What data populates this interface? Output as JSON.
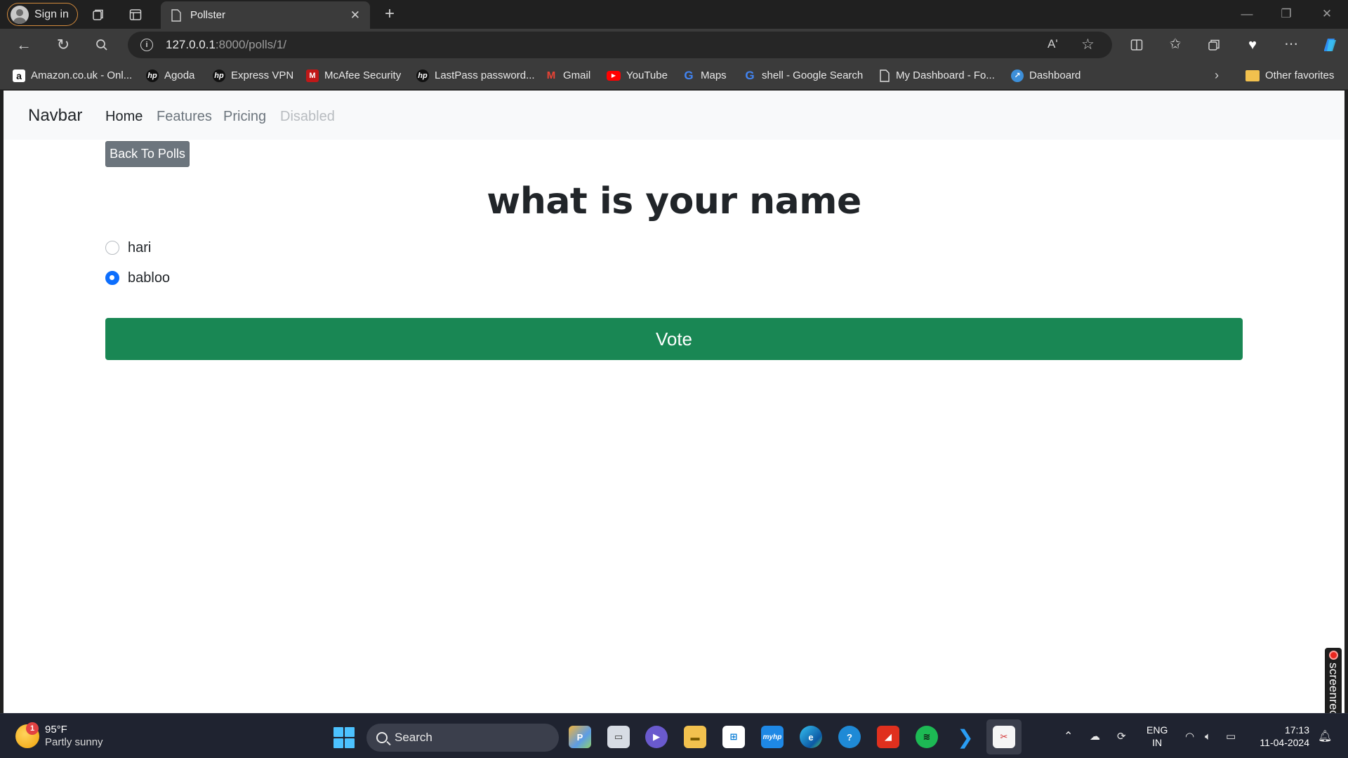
{
  "browser": {
    "signin_label": "Sign in",
    "tab_title": "Pollster",
    "url_host": "127.0.0.1",
    "url_path": ":8000/polls/1/",
    "read_aloud_label": "Aʹ",
    "accent_color": "#d28a3c"
  },
  "bookmarks": {
    "items": [
      {
        "label": "Amazon.co.uk - Onl...",
        "icon": "amazon-icon"
      },
      {
        "label": "Agoda",
        "icon": "hp-icon"
      },
      {
        "label": "Express VPN",
        "icon": "hp-icon"
      },
      {
        "label": "McAfee Security",
        "icon": "mcafee-icon"
      },
      {
        "label": "LastPass password...",
        "icon": "hp-icon"
      },
      {
        "label": "Gmail",
        "icon": "gmail-icon"
      },
      {
        "label": "YouTube",
        "icon": "youtube-icon"
      },
      {
        "label": "Maps",
        "icon": "google-icon"
      },
      {
        "label": "shell - Google Search",
        "icon": "google-icon"
      },
      {
        "label": "My Dashboard - Fo...",
        "icon": "page-icon"
      },
      {
        "label": "Dashboard",
        "icon": "dashboard-icon"
      }
    ],
    "other_favorites": "Other favorites"
  },
  "navbar": {
    "brand": "Navbar",
    "links": [
      {
        "label": "Home",
        "state": "active"
      },
      {
        "label": "Features",
        "state": "normal"
      },
      {
        "label": "Pricing",
        "state": "normal"
      },
      {
        "label": "Disabled",
        "state": "disabled"
      }
    ]
  },
  "poll": {
    "back_label": "Back To Polls",
    "question": "what is your name",
    "choices": [
      {
        "label": "hari",
        "checked": false
      },
      {
        "label": "babloo",
        "checked": true
      }
    ],
    "vote_label": "Vote",
    "vote_color": "#198754",
    "back_color": "#6c757d",
    "radio_color": "#0d6efd"
  },
  "overlay": {
    "screenrec_label": "screenrec"
  },
  "taskbar": {
    "weather_temp": "95°F",
    "weather_desc": "Partly sunny",
    "weather_badge": "1",
    "search_label": "Search",
    "lang_line1": "ENG",
    "lang_line2": "IN",
    "time": "17:13",
    "date": "11-04-2024"
  }
}
